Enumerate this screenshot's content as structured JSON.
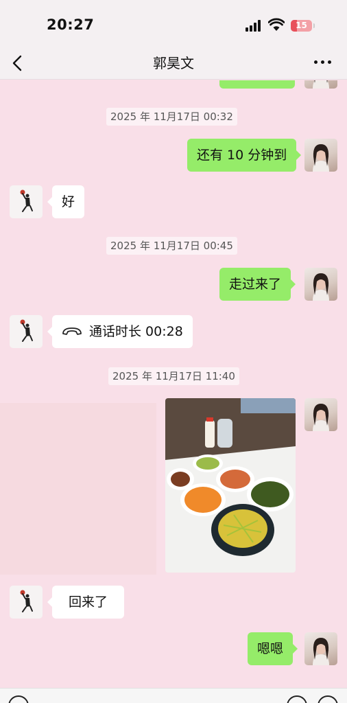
{
  "status_bar": {
    "time": "20:27",
    "battery": "15"
  },
  "header": {
    "title": "郭昊文"
  },
  "timestamps": [
    "2025 年 11月17日 00:32",
    "2025 年 11月17日 00:45",
    "2025 年 11月17日 11:40"
  ],
  "messages": {
    "sent_1": "还有 10 分钟到",
    "recv_1": "好",
    "sent_2": "走过来了",
    "call": "通话时长 00:28",
    "recv_2": "回来了",
    "sent_3": "嗯嗯"
  },
  "icons": {
    "back": "chevron-left-icon",
    "more": "more-dots-icon",
    "call": "phone-handset-icon",
    "voice": "voice-icon",
    "emoji": "emoji-icon",
    "add": "plus-icon"
  },
  "colors": {
    "sent_bubble": "#95ec69",
    "received_bubble": "#ffffff",
    "chat_background": "#f9dfe8",
    "battery_low": "#e8505b"
  }
}
